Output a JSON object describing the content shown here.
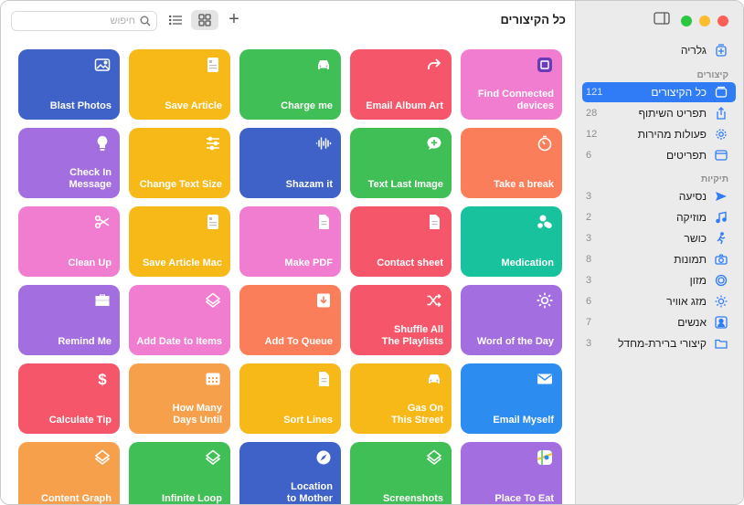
{
  "sidebar": {
    "gallery": {
      "label": "גלריה"
    },
    "shortcuts_header": "קיצורים",
    "shortcuts": [
      {
        "label": "כל הקיצורים",
        "count": "121",
        "icon": "all-shortcuts-icon",
        "active": true
      },
      {
        "label": "תפריט השיתוף",
        "count": "28",
        "icon": "share-icon"
      },
      {
        "label": "פעולות מהירות",
        "count": "12",
        "icon": "gear-icon"
      },
      {
        "label": "תפריטים",
        "count": "6",
        "icon": "menu-window-icon"
      }
    ],
    "folders_header": "תיקיות",
    "folders": [
      {
        "label": "נסיעה",
        "count": "3",
        "icon": "plane-icon"
      },
      {
        "label": "מוזיקה",
        "count": "2",
        "icon": "music-note-icon"
      },
      {
        "label": "כושר",
        "count": "3",
        "icon": "running-icon"
      },
      {
        "label": "תמונות",
        "count": "8",
        "icon": "camera-icon"
      },
      {
        "label": "מזון",
        "count": "3",
        "icon": "food-icon"
      },
      {
        "label": "מזג אוויר",
        "count": "6",
        "icon": "sun-icon"
      },
      {
        "label": "אנשים",
        "count": "7",
        "icon": "person-icon"
      },
      {
        "label": "קיצורי ברירת-מחדל",
        "count": "3",
        "icon": "folder-icon"
      }
    ]
  },
  "toolbar": {
    "title": "כל הקיצורים",
    "search_placeholder": "חיפוש",
    "add_label": "+"
  },
  "colors": {
    "accent": "#2f7cf6",
    "blue": "#3f62c9",
    "yellow": "#f7b917",
    "green": "#3fbf55",
    "red": "#f5566a",
    "pink": "#f07dd0",
    "purple": "#a36ee0",
    "orange": "#fa7e5a",
    "teal": "#18c29c",
    "sky": "#2d8cf0",
    "peach": "#f7a04c"
  },
  "tiles": [
    {
      "label": "Blast Photos",
      "color": "blue",
      "icon": "photo-icon"
    },
    {
      "label": "Save Article",
      "color": "yellow",
      "icon": "document-icon"
    },
    {
      "label": "Charge me",
      "color": "green",
      "icon": "car-icon"
    },
    {
      "label": "Email Album Art",
      "color": "red",
      "icon": "forward-arrow-icon"
    },
    {
      "label": "Find Connected\ndevices",
      "color": "pink",
      "icon": "app-icon"
    },
    {
      "label": "Check In\nMessage",
      "color": "purple",
      "icon": "lightbulb-icon"
    },
    {
      "label": "Change Text Size",
      "color": "yellow",
      "icon": "sliders-icon"
    },
    {
      "label": "Shazam it",
      "color": "blue",
      "icon": "waveform-icon"
    },
    {
      "label": "Text Last Image",
      "color": "green",
      "icon": "message-plus-icon"
    },
    {
      "label": "Take a break",
      "color": "orange",
      "icon": "timer-icon"
    },
    {
      "label": "Clean Up",
      "color": "pink",
      "icon": "scissors-icon"
    },
    {
      "label": "Save Article Mac",
      "color": "yellow",
      "icon": "document-icon"
    },
    {
      "label": "Make PDF",
      "color": "pink",
      "icon": "page-icon"
    },
    {
      "label": "Contact sheet",
      "color": "red",
      "icon": "page-icon"
    },
    {
      "label": "Medication",
      "color": "teal",
      "icon": "pills-icon"
    },
    {
      "label": "Remind Me",
      "color": "purple",
      "icon": "briefcase-icon"
    },
    {
      "label": "Add Date to Items",
      "color": "pink",
      "icon": "layers-icon"
    },
    {
      "label": "Add To Queue",
      "color": "orange",
      "icon": "download-box-icon"
    },
    {
      "label": "Shuffle All\nThe Playlists",
      "color": "red",
      "icon": "shuffle-icon"
    },
    {
      "label": "Word of the Day",
      "color": "purple",
      "icon": "sun-icon"
    },
    {
      "label": "Calculate Tip",
      "color": "red",
      "icon": "dollar-icon"
    },
    {
      "label": "How Many\nDays Until",
      "color": "peach",
      "icon": "calendar-icon"
    },
    {
      "label": "Sort Lines",
      "color": "yellow",
      "icon": "page-icon"
    },
    {
      "label": "Gas On\nThis Street",
      "color": "yellow",
      "icon": "car-icon"
    },
    {
      "label": "Email Myself",
      "color": "sky",
      "icon": "envelope-icon"
    },
    {
      "label": "Content Graph",
      "color": "peach",
      "icon": "layers-icon"
    },
    {
      "label": "Infinite Loop",
      "color": "green",
      "icon": "layers-icon"
    },
    {
      "label": "Location\nto Mother",
      "color": "blue",
      "icon": "compass-icon"
    },
    {
      "label": "Screenshots",
      "color": "green",
      "icon": "layers-icon"
    },
    {
      "label": "Place To Eat",
      "color": "purple",
      "icon": "maps-icon"
    }
  ]
}
